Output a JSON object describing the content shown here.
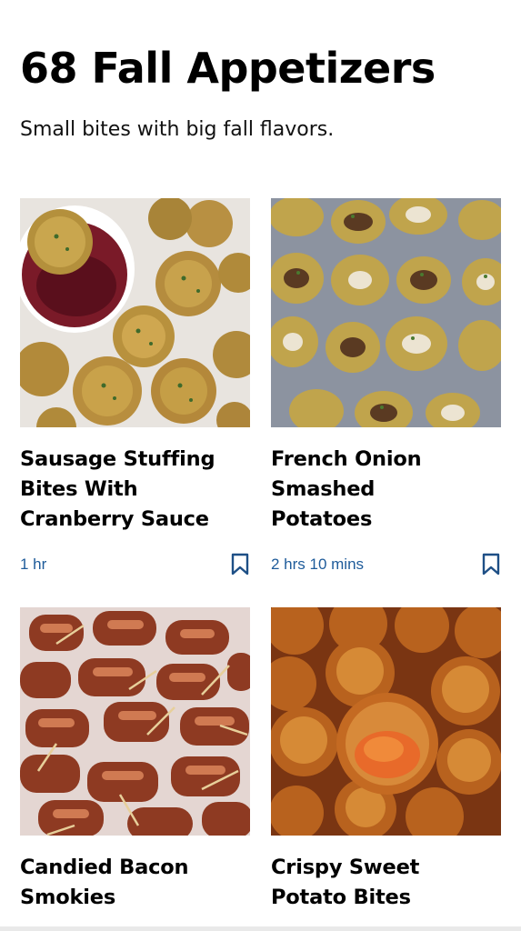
{
  "page": {
    "title": "68 Fall Appetizers",
    "subtitle": "Small bites with big fall flavors."
  },
  "recipes": [
    {
      "title_lines": [
        "Sausage Stuffing",
        "Bites With",
        "Cranberry Sauce"
      ],
      "time": "1 hr",
      "image_icon": "stuffing-bites-photo",
      "bookmark_icon": "bookmark-icon"
    },
    {
      "title_lines": [
        "French Onion",
        "Smashed",
        "Potatoes"
      ],
      "time": "2 hrs 10 mins",
      "image_icon": "smashed-potatoes-photo",
      "bookmark_icon": "bookmark-icon"
    },
    {
      "title_lines": [
        "Candied Bacon",
        "Smokies"
      ],
      "image_icon": "bacon-smokies-photo"
    },
    {
      "title_lines": [
        "Crispy Sweet",
        "Potato Bites"
      ],
      "image_icon": "sweet-potato-bites-photo"
    }
  ],
  "colors": {
    "time_text": "#1e5b9a",
    "bookmark": "#1e4f86"
  }
}
